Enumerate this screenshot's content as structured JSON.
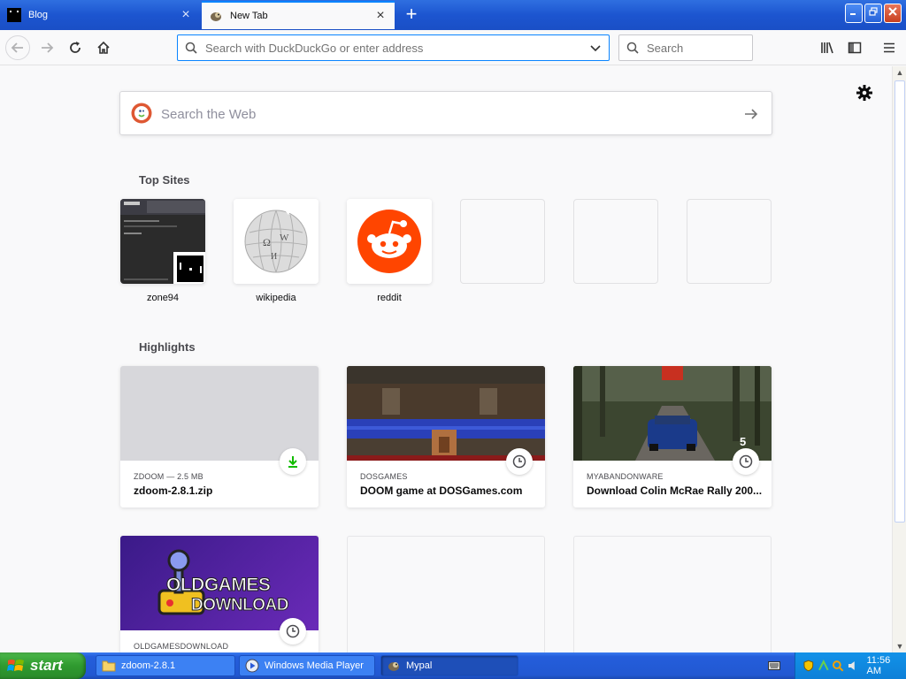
{
  "tabs": [
    {
      "title": "Blog",
      "icon": "blog-favicon",
      "active": false
    },
    {
      "title": "New Tab",
      "icon": "mypal-favicon",
      "active": true
    }
  ],
  "toolbar": {
    "url_placeholder": "Search with DuckDuckGo or enter address",
    "search_placeholder": "Search"
  },
  "newtab": {
    "web_search_placeholder": "Search the Web",
    "top_sites_title": "Top Sites",
    "top_sites": [
      {
        "label": "zone94"
      },
      {
        "label": "wikipedia"
      },
      {
        "label": "reddit"
      },
      {
        "label": ""
      },
      {
        "label": ""
      },
      {
        "label": ""
      }
    ],
    "highlights_title": "Highlights",
    "highlights": [
      {
        "source": "ZDOOM — 2.5 MB",
        "title": "zdoom-2.8.1.zip",
        "badge": "download-icon"
      },
      {
        "source": "DOSGAMES",
        "title": "DOOM game at DOSGames.com",
        "badge": "clock-icon"
      },
      {
        "source": "MYABANDONWARE",
        "title": "Download Colin McRae Rally 200...",
        "badge": "clock-icon"
      },
      {
        "source": "OLDGAMESDOWNLOAD",
        "title": "",
        "badge": "clock-icon",
        "image_text_1": "OLDGAMES",
        "image_text_2": "DOWNLOAD"
      }
    ],
    "rally_badge_number": "5"
  },
  "taskbar": {
    "start_label": "start",
    "tasks": [
      {
        "label": "zdoom-2.8.1",
        "icon": "folder-icon"
      },
      {
        "label": "Windows Media Player",
        "icon": "media-player-icon"
      },
      {
        "label": "Mypal",
        "icon": "mypal-icon"
      }
    ],
    "clock": "11:56 AM"
  },
  "colors": {
    "accent": "#0a84ff",
    "reddit": "#ff4500",
    "download_green": "#12bc00",
    "taskbar_blue": "#245edb",
    "start_green": "#2f9a2f"
  }
}
